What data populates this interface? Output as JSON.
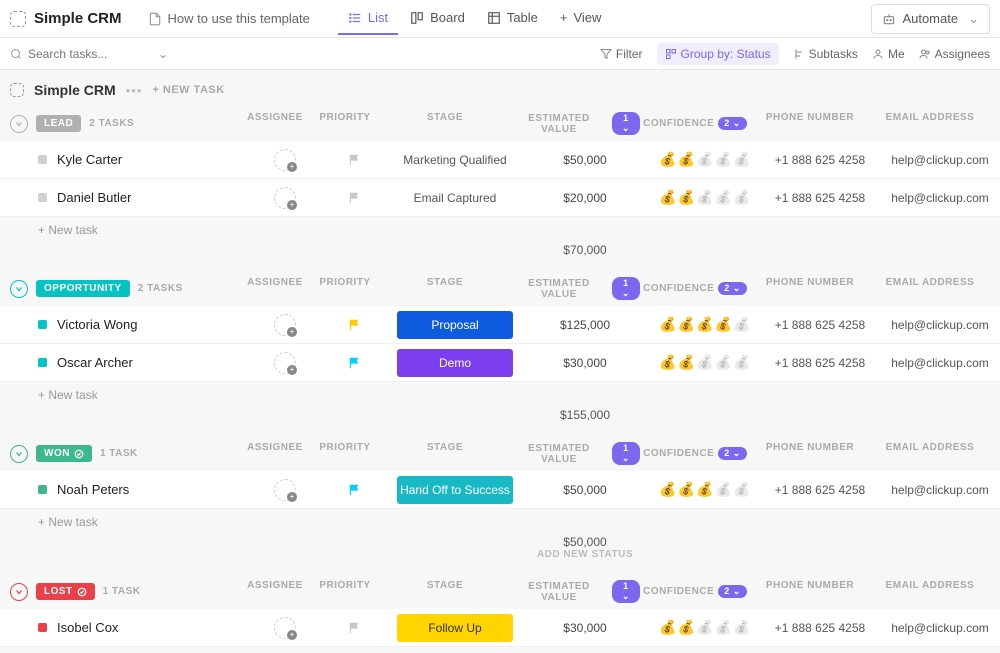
{
  "header": {
    "app_title": "Simple CRM",
    "template_link": "How to use this template",
    "views": {
      "list": "List",
      "board": "Board",
      "table": "Table",
      "add": "View"
    },
    "automate": "Automate"
  },
  "filterbar": {
    "search_placeholder": "Search tasks...",
    "filter": "Filter",
    "group_by": "Group by: Status",
    "subtasks": "Subtasks",
    "me": "Me",
    "assignees": "Assignees"
  },
  "page": {
    "title": "Simple CRM",
    "new_task": "+ NEW TASK"
  },
  "columns": {
    "assignee": "ASSIGNEE",
    "priority": "PRIORITY",
    "stage": "STAGE",
    "estimated": "ESTIMATED VALUE",
    "est_badge": "1",
    "confidence": "CONFIDENCE",
    "conf_badge": "2",
    "phone": "PHONE NUMBER",
    "email": "EMAIL ADDRESS"
  },
  "common": {
    "new_task_row": "+ New task",
    "add_status": "ADD NEW STATUS",
    "phone": "+1 888 625 4258",
    "email": "help@clickup.com"
  },
  "groups": [
    {
      "name": "LEAD",
      "color": "gray",
      "caret_color": "#b0b0b0",
      "count": "2 TASKS",
      "sum": "$70,000",
      "show_icon": false,
      "tasks": [
        {
          "name": "Kyle Carter",
          "dot": "#d0d0d0",
          "flag": "#c8c8c8",
          "stage": "Marketing Qualified",
          "stage_bg": "",
          "est": "$50,000",
          "conf": 2
        },
        {
          "name": "Daniel Butler",
          "dot": "#d0d0d0",
          "flag": "#c8c8c8",
          "stage": "Email Captured",
          "stage_bg": "",
          "est": "$20,000",
          "conf": 2
        }
      ]
    },
    {
      "name": "OPPORTUNITY",
      "color": "teal",
      "caret_color": "#06c3c3",
      "count": "2 TASKS",
      "sum": "$155,000",
      "show_icon": false,
      "tasks": [
        {
          "name": "Victoria Wong",
          "dot": "#06c3c3",
          "flag": "#ffcc00",
          "stage": "Proposal",
          "stage_bg": "#0f5be0",
          "est": "$125,000",
          "conf": 4
        },
        {
          "name": "Oscar Archer",
          "dot": "#06c3c3",
          "flag": "#00cfff",
          "stage": "Demo",
          "stage_bg": "#7b3ff0",
          "est": "$30,000",
          "conf": 2
        }
      ]
    },
    {
      "name": "WON",
      "color": "green",
      "caret_color": "#3db88b",
      "count": "1 TASK",
      "sum": "$50,000",
      "show_icon": true,
      "show_add_status": true,
      "tasks": [
        {
          "name": "Noah Peters",
          "dot": "#3db88b",
          "flag": "#00cfff",
          "stage": "Hand Off to Success",
          "stage_bg": "#18b9c4",
          "est": "$50,000",
          "conf": 3
        }
      ]
    },
    {
      "name": "LOST",
      "color": "red",
      "caret_color": "#e8414a",
      "count": "1 TASK",
      "sum": "",
      "show_icon": true,
      "tasks": [
        {
          "name": "Isobel Cox",
          "dot": "#e8414a",
          "flag": "#c8c8c8",
          "stage": "Follow Up",
          "stage_bg": "#ffd400",
          "stage_fg": "#333",
          "est": "$30,000",
          "conf": 2
        }
      ]
    }
  ]
}
